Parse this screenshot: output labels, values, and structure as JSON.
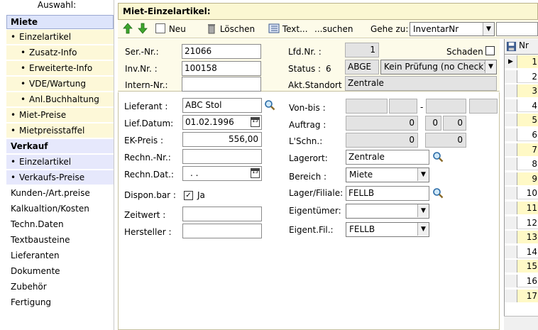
{
  "sidebar": {
    "header": "Auswahl:",
    "items": [
      {
        "label": "Miete"
      },
      {
        "label": "Einzelartikel"
      },
      {
        "label": "Zusatz-Info"
      },
      {
        "label": "Erweiterte-Info"
      },
      {
        "label": "VDE/Wartung"
      },
      {
        "label": "Anl.Buchhaltung"
      },
      {
        "label": "Miet-Preise"
      },
      {
        "label": "Mietpreisstaffel"
      },
      {
        "label": "Verkauf"
      },
      {
        "label": "Einzelartikel"
      },
      {
        "label": "Verkaufs-Preise"
      },
      {
        "label": "Kunden-/Art.preise"
      },
      {
        "label": "Kalkualtion/Kosten"
      },
      {
        "label": "Techn.Daten"
      },
      {
        "label": "Textbausteine"
      },
      {
        "label": "Lieferanten"
      },
      {
        "label": "Dokumente"
      },
      {
        "label": "Zubehör"
      },
      {
        "label": "Fertigung"
      }
    ]
  },
  "title": "Miet-Einzelartikel:",
  "toolbar": {
    "new_label": "Neu",
    "delete_label": "Löschen",
    "text_label": "Text...",
    "search_label": "...suchen",
    "goto_label": "Gehe zu:",
    "goto_value": "InventarNr"
  },
  "top": {
    "ser_nr_label": "Ser.-Nr.:",
    "ser_nr_value": "21066",
    "inv_nr_label": "Inv.Nr. :",
    "inv_nr_value": "100158",
    "intern_nr_label": "Intern-Nr.:",
    "intern_nr_value": "",
    "lfd_nr_label": "Lfd.Nr. :",
    "lfd_nr_value": "1",
    "schaden_label": "Schaden",
    "status_label": "Status :",
    "status_num": "6",
    "status_code": "ABGE",
    "status_text": "Kein Prüfung (no Check)",
    "standort_label": "Akt.Standort :",
    "standort_value": "Zentrale"
  },
  "form": {
    "lieferant_label": "Lieferant :",
    "lieferant_value": "ABC Stol",
    "lief_datum_label": "Lief.Datum:",
    "lief_datum_value": "01.02.1996",
    "ek_preis_label": "EK-Preis :",
    "ek_preis_value": "556,00",
    "rechn_nr_label": "Rechn.-Nr.:",
    "rechn_nr_value": "",
    "rechn_dat_label": "Rechn.Dat.:",
    "rechn_dat_value": ". .",
    "dispon_label": "Dispon.bar :",
    "dispon_value": "Ja",
    "zeitwert_label": "Zeitwert :",
    "zeitwert_value": "",
    "hersteller_label": "Hersteller :",
    "hersteller_value": "",
    "von_bis_label": "Von-bis :",
    "von_bis_sep": "-",
    "auftrag_label": "Auftrag :",
    "auftrag_value": "0",
    "auftrag_a": "0",
    "auftrag_b": "0",
    "lschn_label": "L'Schn.:",
    "lschn_value": "0",
    "lschn_b": "0",
    "lagerort_label": "Lagerort:",
    "lagerort_value": "Zentrale",
    "bereich_label": "Bereich :",
    "bereich_value": "Miete",
    "lager_filiale_label": "Lager/Filiale:",
    "lager_filiale_value": "FELLB",
    "eigentuemer_label": "Eigentümer:",
    "eigentuemer_value": "",
    "eigent_fil_label": "Eigent.Fil.:",
    "eigent_fil_value": "FELLB"
  },
  "grid": {
    "header": "Nr",
    "rows": [
      "1",
      "2",
      "3",
      "4",
      "5",
      "6",
      "7",
      "8",
      "9",
      "10",
      "11",
      "12",
      "13",
      "14",
      "15",
      "16",
      "17"
    ]
  },
  "colors": {
    "sidebar_selected": "#dde4fb",
    "sidebar_section": "#e6e8fc",
    "sidebar_sub": "#fdf8d8",
    "panel": "#fdfbe9",
    "grid_alt": "#fff9c6"
  }
}
